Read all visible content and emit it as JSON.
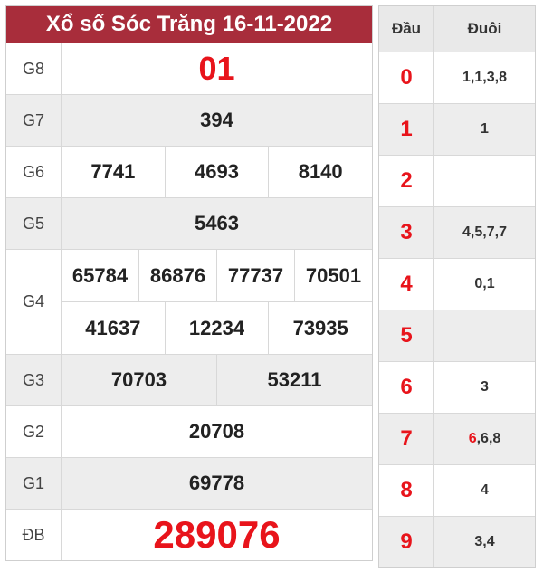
{
  "title": "Xổ số Sóc Trăng 16-11-2022",
  "prizes": {
    "g8": {
      "label": "G8",
      "values": [
        "01"
      ]
    },
    "g7": {
      "label": "G7",
      "values": [
        "394"
      ]
    },
    "g6": {
      "label": "G6",
      "values": [
        "7741",
        "4693",
        "8140"
      ]
    },
    "g5": {
      "label": "G5",
      "values": [
        "5463"
      ]
    },
    "g4": {
      "label": "G4",
      "row1": [
        "65784",
        "86876",
        "77737",
        "70501"
      ],
      "row2": [
        "41637",
        "12234",
        "73935"
      ]
    },
    "g3": {
      "label": "G3",
      "values": [
        "70703",
        "53211"
      ]
    },
    "g2": {
      "label": "G2",
      "values": [
        "20708"
      ]
    },
    "g1": {
      "label": "G1",
      "values": [
        "69778"
      ]
    },
    "db": {
      "label": "ĐB",
      "values": [
        "289076"
      ]
    }
  },
  "tail_table": {
    "header_dau": "Đầu",
    "header_duoi": "Đuôi",
    "rows": [
      {
        "dau": "0",
        "duoi": "1,1,3,8"
      },
      {
        "dau": "1",
        "duoi": "1"
      },
      {
        "dau": "2",
        "duoi": ""
      },
      {
        "dau": "3",
        "duoi": "4,5,7,7"
      },
      {
        "dau": "4",
        "duoi": "0,1"
      },
      {
        "dau": "5",
        "duoi": ""
      },
      {
        "dau": "6",
        "duoi": "3"
      },
      {
        "dau": "7",
        "duoi_highlight": "6",
        "duoi_rest": ",6,8"
      },
      {
        "dau": "8",
        "duoi": "4"
      },
      {
        "dau": "9",
        "duoi": "3,4"
      }
    ]
  },
  "colors": {
    "header_bg": "#a82d3b",
    "highlight_red": "#e8141b",
    "alt_row_bg": "#ededed"
  }
}
